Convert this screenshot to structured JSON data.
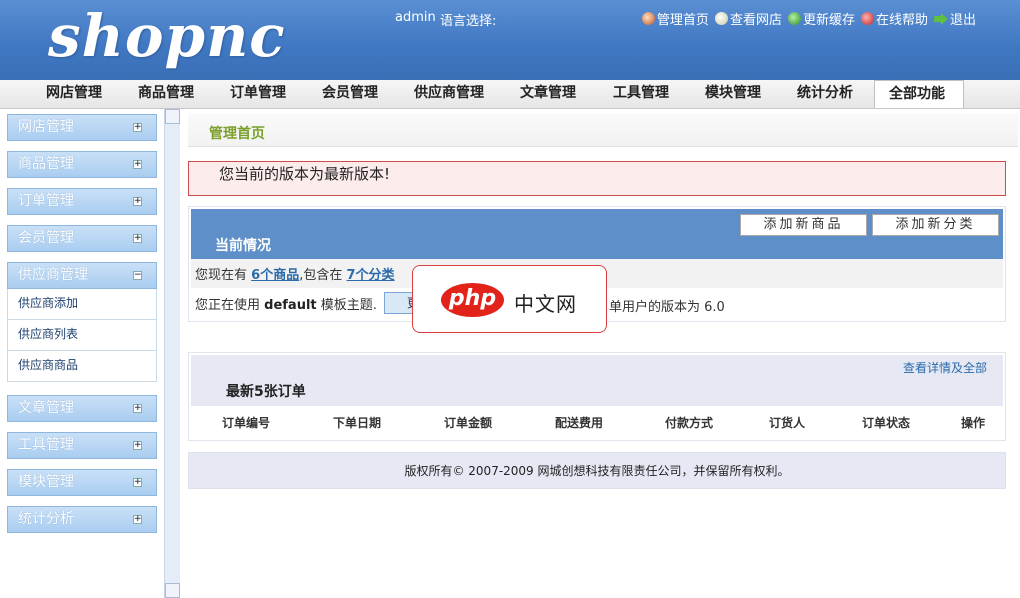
{
  "header": {
    "logo": "shopnc",
    "admin_name": "admin",
    "lang_label": "语言选择:",
    "links": [
      {
        "icon": "user-icon",
        "label": "管理首页"
      },
      {
        "icon": "globe-icon",
        "label": "查看网店"
      },
      {
        "icon": "refresh-icon",
        "label": "更新缓存"
      },
      {
        "icon": "help-icon",
        "label": "在线帮助"
      },
      {
        "icon": "logout-arrow-icon",
        "label": "退出"
      }
    ]
  },
  "nav": {
    "tabs": [
      "网店管理",
      "商品管理",
      "订单管理",
      "会员管理",
      "供应商管理",
      "文章管理",
      "工具管理",
      "模块管理",
      "统计分析",
      "全部功能"
    ],
    "active": "全部功能"
  },
  "sidebar": {
    "groups": [
      {
        "label": "网店管理",
        "toggle": "+"
      },
      {
        "label": "商品管理",
        "toggle": "+"
      },
      {
        "label": "订单管理",
        "toggle": "+"
      },
      {
        "label": "会员管理",
        "toggle": "+"
      },
      {
        "label": "供应商管理",
        "toggle": "−",
        "items": [
          "供应商添加",
          "供应商列表",
          "供应商商品"
        ]
      },
      {
        "label": "文章管理",
        "toggle": "+"
      },
      {
        "label": "工具管理",
        "toggle": "+"
      },
      {
        "label": "模块管理",
        "toggle": "+"
      },
      {
        "label": "统计分析",
        "toggle": "+"
      }
    ]
  },
  "main": {
    "page_title": "管理首页",
    "notice": "您当前的版本为最新版本!",
    "status": {
      "title": "当前情况",
      "btn_add_goods": "添加新商品",
      "btn_add_category": "添加新分类",
      "row1_prefix": "您现在有",
      "goods_link": "6个商品",
      "row1_mid": ",包含在",
      "category_link": "7个分类",
      "row2_prefix": "您正在使用",
      "template": "default",
      "row2_suffix": "模板主题.",
      "switch_btn": "更",
      "version_text": "单用户的版本为 6.0"
    },
    "orders": {
      "title": "最新5张订单",
      "more_link": "查看详情及全部",
      "columns": [
        "订单编号",
        "下单日期",
        "订单金额",
        "配送费用",
        "付款方式",
        "订货人",
        "订单状态",
        "操作"
      ]
    },
    "footer": "版权所有© 2007-2009 网城创想科技有限责任公司，并保留所有权利。"
  },
  "watermark": {
    "logo": "php",
    "text": "中文网"
  }
}
